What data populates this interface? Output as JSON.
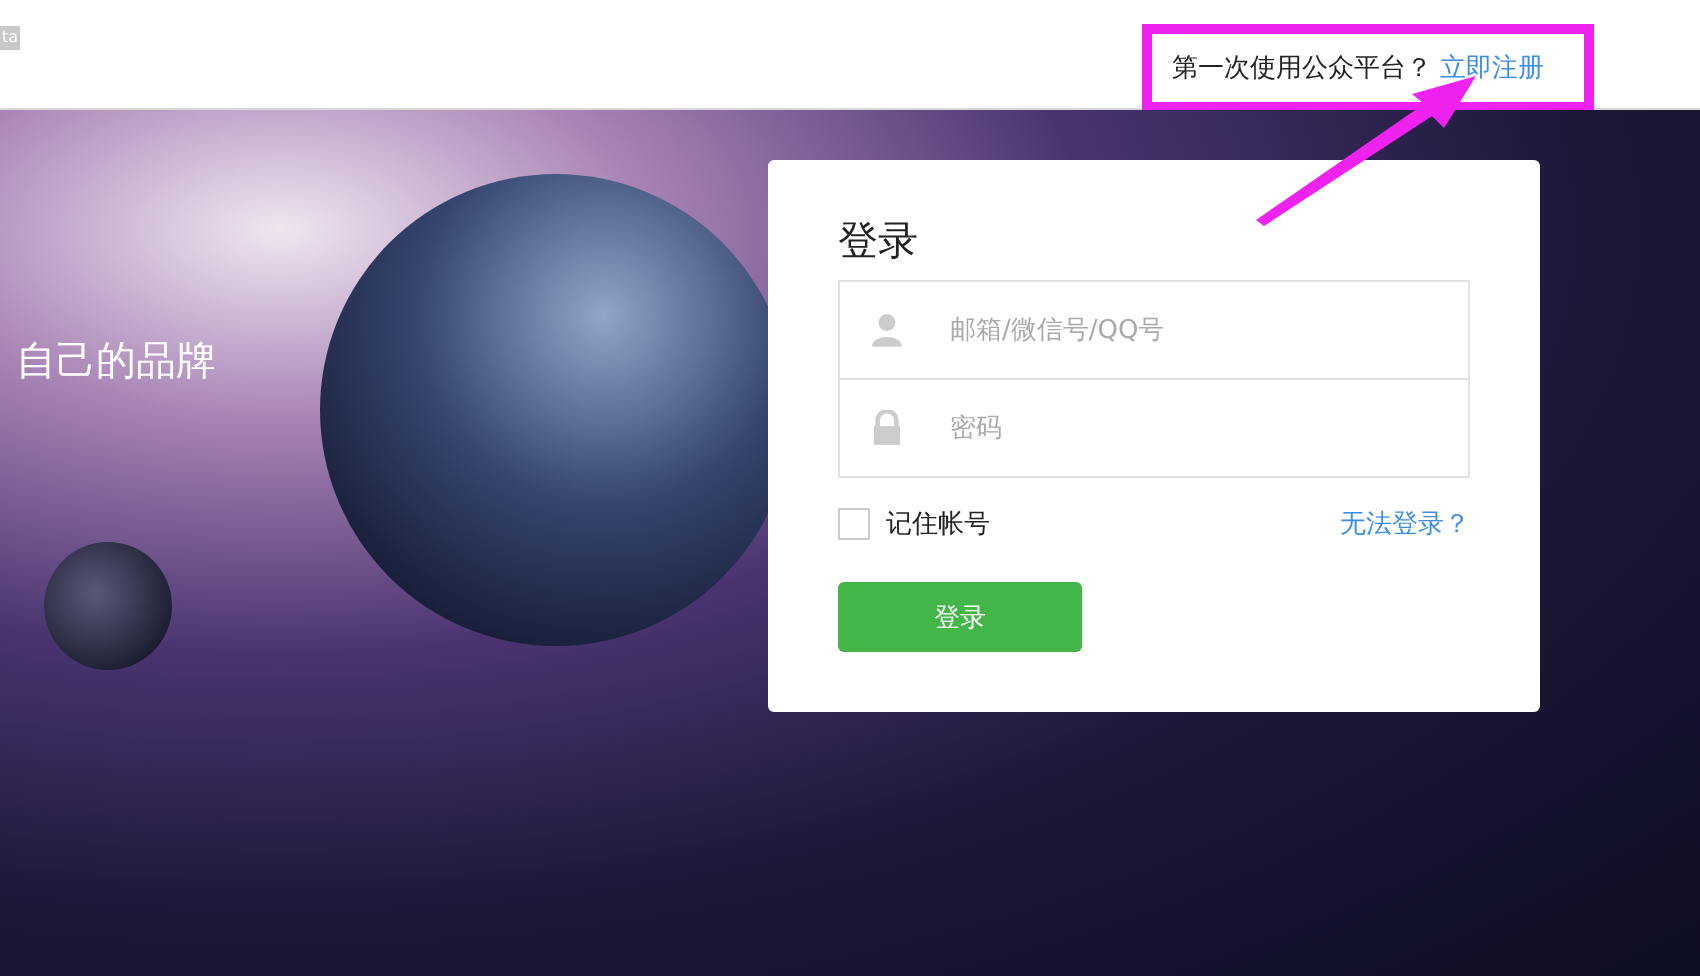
{
  "header": {
    "badge": "ta",
    "signup_prompt": "第一次使用公众平台？",
    "signup_link": "立即注册"
  },
  "hero": {
    "slogan": "自己的品牌"
  },
  "login": {
    "title": "登录",
    "account_placeholder": "邮箱/微信号/QQ号",
    "password_placeholder": "密码",
    "remember": {
      "label": "记住帐号",
      "checked": false
    },
    "forgot_link": "无法登录？",
    "submit": "登录"
  }
}
